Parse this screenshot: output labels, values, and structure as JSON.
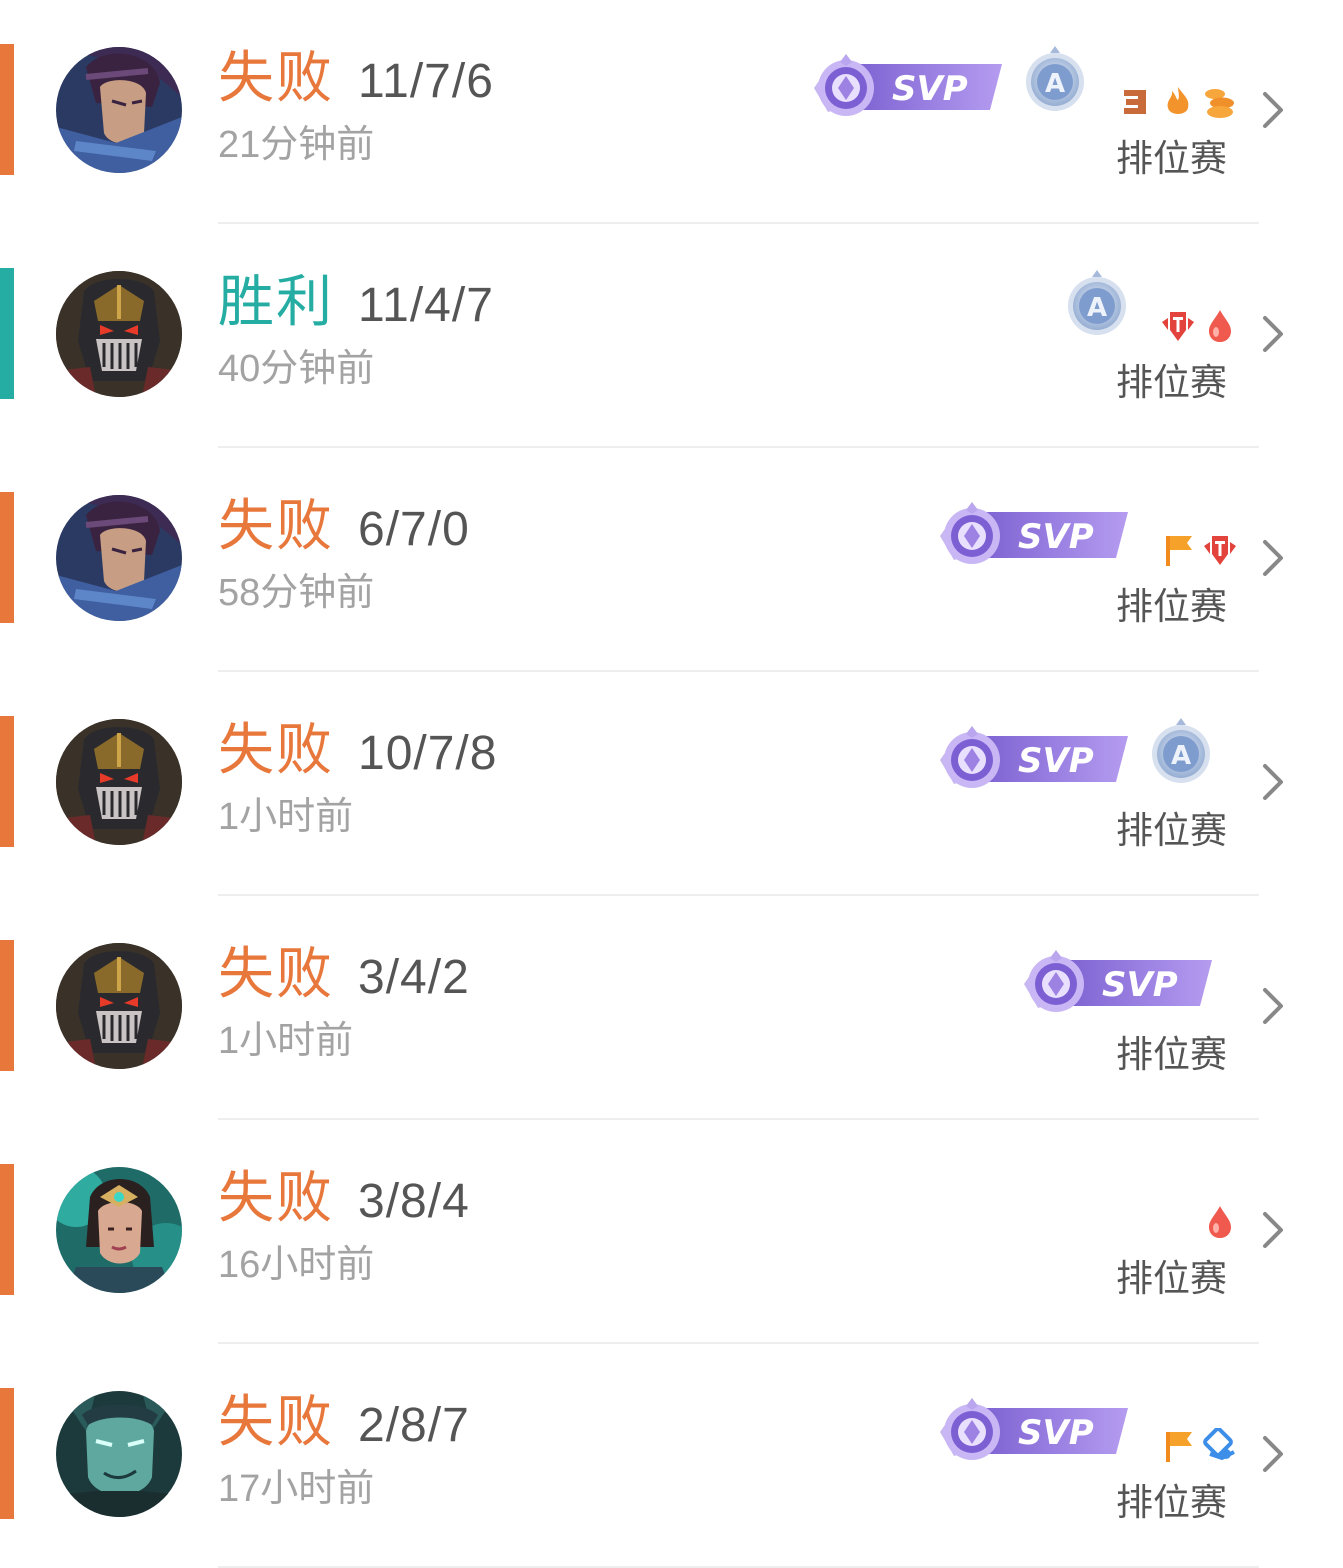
{
  "colors": {
    "loss": "#e8773c",
    "win": "#26ada3",
    "svp": "#8a6fd6",
    "rank": "#7a9bd0"
  },
  "matches": [
    {
      "result": "失败",
      "outcome": "loss",
      "kda": "11/7/6",
      "time": "21分钟前",
      "mode": "排位赛",
      "hero": "swordsman-portrait",
      "badges": [
        "svp-badge",
        "rank-a-badge"
      ],
      "icons": [
        "triple-kill-icon",
        "fire-icon",
        "coins-icon"
      ]
    },
    {
      "result": "胜利",
      "outcome": "win",
      "kda": "11/4/7",
      "time": "40分钟前",
      "mode": "排位赛",
      "hero": "masked-warrior-portrait",
      "badges": [
        "rank-a-badge"
      ],
      "icons": [
        "tower-icon",
        "blood-drop-icon"
      ]
    },
    {
      "result": "失败",
      "outcome": "loss",
      "kda": "6/7/0",
      "time": "58分钟前",
      "mode": "排位赛",
      "hero": "swordsman-portrait",
      "badges": [
        "svp-badge"
      ],
      "icons": [
        "flag-icon",
        "tower-icon"
      ]
    },
    {
      "result": "失败",
      "outcome": "loss",
      "kda": "10/7/8",
      "time": "1小时前",
      "mode": "排位赛",
      "hero": "masked-warrior-portrait",
      "badges": [
        "svp-badge",
        "rank-a-badge"
      ],
      "icons": []
    },
    {
      "result": "失败",
      "outcome": "loss",
      "kda": "3/4/2",
      "time": "1小时前",
      "mode": "排位赛",
      "hero": "masked-warrior-portrait",
      "badges": [
        "svp-badge"
      ],
      "icons": []
    },
    {
      "result": "失败",
      "outcome": "loss",
      "kda": "3/8/4",
      "time": "16小时前",
      "mode": "排位赛",
      "hero": "jade-mage-portrait",
      "badges": [],
      "icons": [
        "blood-drop-icon"
      ]
    },
    {
      "result": "失败",
      "outcome": "loss",
      "kda": "2/8/7",
      "time": "17小时前",
      "mode": "排位赛",
      "hero": "teal-fighter-portrait",
      "badges": [
        "svp-badge"
      ],
      "icons": [
        "flag-icon",
        "vision-icon"
      ]
    }
  ]
}
